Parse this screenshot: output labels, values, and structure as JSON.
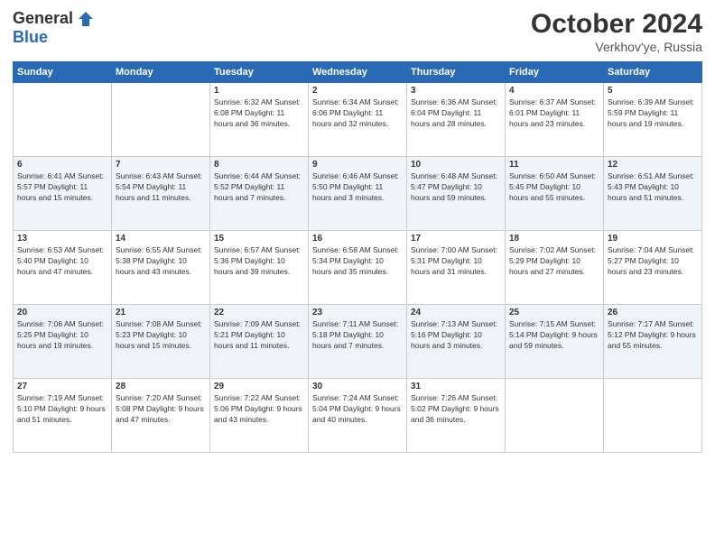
{
  "header": {
    "logo_general": "General",
    "logo_blue": "Blue",
    "month_year": "October 2024",
    "location": "Verkhov'ye, Russia"
  },
  "weekdays": [
    "Sunday",
    "Monday",
    "Tuesday",
    "Wednesday",
    "Thursday",
    "Friday",
    "Saturday"
  ],
  "weeks": [
    [
      {
        "day": "",
        "info": ""
      },
      {
        "day": "",
        "info": ""
      },
      {
        "day": "1",
        "info": "Sunrise: 6:32 AM\nSunset: 6:08 PM\nDaylight: 11 hours\nand 36 minutes."
      },
      {
        "day": "2",
        "info": "Sunrise: 6:34 AM\nSunset: 6:06 PM\nDaylight: 11 hours\nand 32 minutes."
      },
      {
        "day": "3",
        "info": "Sunrise: 6:36 AM\nSunset: 6:04 PM\nDaylight: 11 hours\nand 28 minutes."
      },
      {
        "day": "4",
        "info": "Sunrise: 6:37 AM\nSunset: 6:01 PM\nDaylight: 11 hours\nand 23 minutes."
      },
      {
        "day": "5",
        "info": "Sunrise: 6:39 AM\nSunset: 5:59 PM\nDaylight: 11 hours\nand 19 minutes."
      }
    ],
    [
      {
        "day": "6",
        "info": "Sunrise: 6:41 AM\nSunset: 5:57 PM\nDaylight: 11 hours\nand 15 minutes."
      },
      {
        "day": "7",
        "info": "Sunrise: 6:43 AM\nSunset: 5:54 PM\nDaylight: 11 hours\nand 11 minutes."
      },
      {
        "day": "8",
        "info": "Sunrise: 6:44 AM\nSunset: 5:52 PM\nDaylight: 11 hours\nand 7 minutes."
      },
      {
        "day": "9",
        "info": "Sunrise: 6:46 AM\nSunset: 5:50 PM\nDaylight: 11 hours\nand 3 minutes."
      },
      {
        "day": "10",
        "info": "Sunrise: 6:48 AM\nSunset: 5:47 PM\nDaylight: 10 hours\nand 59 minutes."
      },
      {
        "day": "11",
        "info": "Sunrise: 6:50 AM\nSunset: 5:45 PM\nDaylight: 10 hours\nand 55 minutes."
      },
      {
        "day": "12",
        "info": "Sunrise: 6:51 AM\nSunset: 5:43 PM\nDaylight: 10 hours\nand 51 minutes."
      }
    ],
    [
      {
        "day": "13",
        "info": "Sunrise: 6:53 AM\nSunset: 5:40 PM\nDaylight: 10 hours\nand 47 minutes."
      },
      {
        "day": "14",
        "info": "Sunrise: 6:55 AM\nSunset: 5:38 PM\nDaylight: 10 hours\nand 43 minutes."
      },
      {
        "day": "15",
        "info": "Sunrise: 6:57 AM\nSunset: 5:36 PM\nDaylight: 10 hours\nand 39 minutes."
      },
      {
        "day": "16",
        "info": "Sunrise: 6:58 AM\nSunset: 5:34 PM\nDaylight: 10 hours\nand 35 minutes."
      },
      {
        "day": "17",
        "info": "Sunrise: 7:00 AM\nSunset: 5:31 PM\nDaylight: 10 hours\nand 31 minutes."
      },
      {
        "day": "18",
        "info": "Sunrise: 7:02 AM\nSunset: 5:29 PM\nDaylight: 10 hours\nand 27 minutes."
      },
      {
        "day": "19",
        "info": "Sunrise: 7:04 AM\nSunset: 5:27 PM\nDaylight: 10 hours\nand 23 minutes."
      }
    ],
    [
      {
        "day": "20",
        "info": "Sunrise: 7:06 AM\nSunset: 5:25 PM\nDaylight: 10 hours\nand 19 minutes."
      },
      {
        "day": "21",
        "info": "Sunrise: 7:08 AM\nSunset: 5:23 PM\nDaylight: 10 hours\nand 15 minutes."
      },
      {
        "day": "22",
        "info": "Sunrise: 7:09 AM\nSunset: 5:21 PM\nDaylight: 10 hours\nand 11 minutes."
      },
      {
        "day": "23",
        "info": "Sunrise: 7:11 AM\nSunset: 5:18 PM\nDaylight: 10 hours\nand 7 minutes."
      },
      {
        "day": "24",
        "info": "Sunrise: 7:13 AM\nSunset: 5:16 PM\nDaylight: 10 hours\nand 3 minutes."
      },
      {
        "day": "25",
        "info": "Sunrise: 7:15 AM\nSunset: 5:14 PM\nDaylight: 9 hours\nand 59 minutes."
      },
      {
        "day": "26",
        "info": "Sunrise: 7:17 AM\nSunset: 5:12 PM\nDaylight: 9 hours\nand 55 minutes."
      }
    ],
    [
      {
        "day": "27",
        "info": "Sunrise: 7:19 AM\nSunset: 5:10 PM\nDaylight: 9 hours\nand 51 minutes."
      },
      {
        "day": "28",
        "info": "Sunrise: 7:20 AM\nSunset: 5:08 PM\nDaylight: 9 hours\nand 47 minutes."
      },
      {
        "day": "29",
        "info": "Sunrise: 7:22 AM\nSunset: 5:06 PM\nDaylight: 9 hours\nand 43 minutes."
      },
      {
        "day": "30",
        "info": "Sunrise: 7:24 AM\nSunset: 5:04 PM\nDaylight: 9 hours\nand 40 minutes."
      },
      {
        "day": "31",
        "info": "Sunrise: 7:26 AM\nSunset: 5:02 PM\nDaylight: 9 hours\nand 36 minutes."
      },
      {
        "day": "",
        "info": ""
      },
      {
        "day": "",
        "info": ""
      }
    ]
  ]
}
